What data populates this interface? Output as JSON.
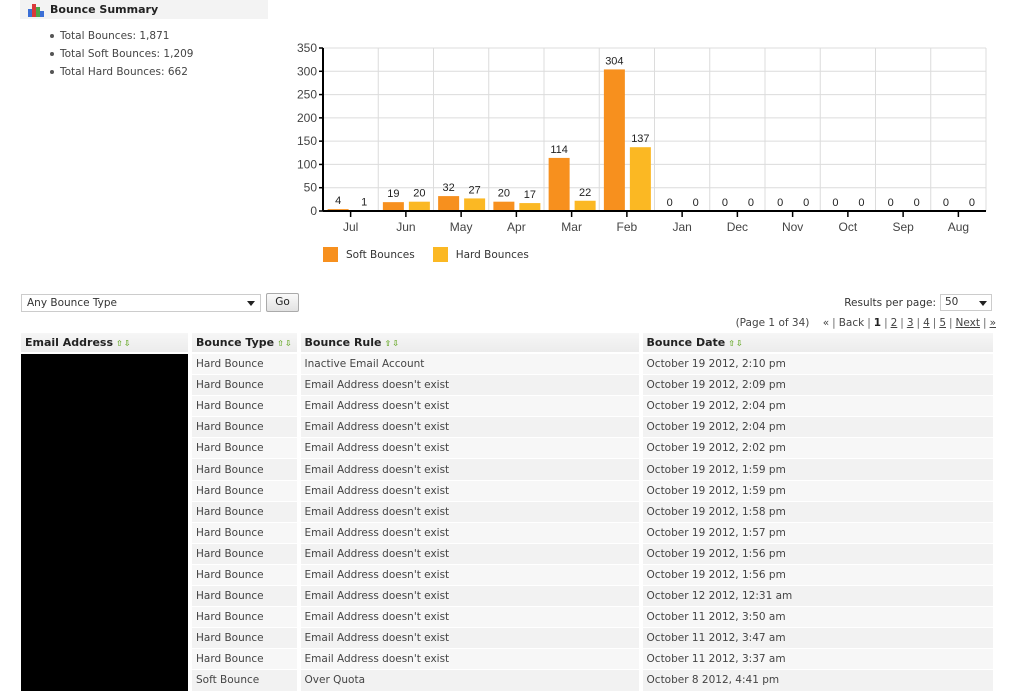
{
  "summary": {
    "title": "Bounce Summary",
    "icon": "bar-chart-icon",
    "items": [
      "Total Bounces: 1,871",
      "Total Soft Bounces: 1,209",
      "Total Hard Bounces: 662"
    ]
  },
  "chart_data": {
    "type": "bar",
    "title": "",
    "xlabel": "",
    "ylabel": "",
    "ylim": [
      0,
      350
    ],
    "yticks": [
      0,
      50,
      100,
      150,
      200,
      250,
      300,
      350
    ],
    "grid": true,
    "legend_position": "bottom-left",
    "categories": [
      "Jul",
      "Jun",
      "May",
      "Apr",
      "Mar",
      "Feb",
      "Jan",
      "Dec",
      "Nov",
      "Oct",
      "Sep",
      "Aug"
    ],
    "series": [
      {
        "name": "Soft Bounces",
        "color": "#f7901e",
        "values": [
          4,
          19,
          32,
          20,
          114,
          304,
          0,
          0,
          0,
          0,
          0,
          0
        ]
      },
      {
        "name": "Hard Bounces",
        "color": "#fbb823",
        "values": [
          1,
          20,
          27,
          17,
          22,
          137,
          0,
          0,
          0,
          0,
          0,
          0
        ]
      }
    ]
  },
  "legend": {
    "items": [
      {
        "label": "Soft Bounces",
        "color": "#f7901e"
      },
      {
        "label": "Hard Bounces",
        "color": "#fbb823"
      }
    ]
  },
  "filter": {
    "selected": "Any Bounce Type",
    "go_label": "Go"
  },
  "results_per_page": {
    "label": "Results per page:",
    "value": "50"
  },
  "pager": {
    "info": "(Page 1 of 34)",
    "first": "«",
    "back": "Back",
    "current": "1",
    "pages": [
      "2",
      "3",
      "4",
      "5"
    ],
    "next": "Next",
    "last": "»"
  },
  "table": {
    "headers": [
      "Email Address",
      "Bounce Type",
      "Bounce Rule",
      "Bounce Date"
    ],
    "sort_icons": "sort-up-down-arrows",
    "rows": [
      {
        "type": "Hard Bounce",
        "rule": "Inactive Email Account",
        "date": "October 19 2012, 2:10 pm"
      },
      {
        "type": "Hard Bounce",
        "rule": "Email Address doesn't exist",
        "date": "October 19 2012, 2:09 pm"
      },
      {
        "type": "Hard Bounce",
        "rule": "Email Address doesn't exist",
        "date": "October 19 2012, 2:04 pm"
      },
      {
        "type": "Hard Bounce",
        "rule": "Email Address doesn't exist",
        "date": "October 19 2012, 2:04 pm"
      },
      {
        "type": "Hard Bounce",
        "rule": "Email Address doesn't exist",
        "date": "October 19 2012, 2:02 pm"
      },
      {
        "type": "Hard Bounce",
        "rule": "Email Address doesn't exist",
        "date": "October 19 2012, 1:59 pm"
      },
      {
        "type": "Hard Bounce",
        "rule": "Email Address doesn't exist",
        "date": "October 19 2012, 1:59 pm"
      },
      {
        "type": "Hard Bounce",
        "rule": "Email Address doesn't exist",
        "date": "October 19 2012, 1:58 pm"
      },
      {
        "type": "Hard Bounce",
        "rule": "Email Address doesn't exist",
        "date": "October 19 2012, 1:57 pm"
      },
      {
        "type": "Hard Bounce",
        "rule": "Email Address doesn't exist",
        "date": "October 19 2012, 1:56 pm"
      },
      {
        "type": "Hard Bounce",
        "rule": "Email Address doesn't exist",
        "date": "October 19 2012, 1:56 pm"
      },
      {
        "type": "Hard Bounce",
        "rule": "Email Address doesn't exist",
        "date": "October 12 2012, 12:31 am"
      },
      {
        "type": "Hard Bounce",
        "rule": "Email Address doesn't exist",
        "date": "October 11 2012, 3:50 am"
      },
      {
        "type": "Hard Bounce",
        "rule": "Email Address doesn't exist",
        "date": "October 11 2012, 3:47 am"
      },
      {
        "type": "Hard Bounce",
        "rule": "Email Address doesn't exist",
        "date": "October 11 2012, 3:37 am"
      },
      {
        "type": "Soft Bounce",
        "rule": "Over Quota",
        "date": "October 8 2012, 4:41 pm"
      }
    ]
  }
}
